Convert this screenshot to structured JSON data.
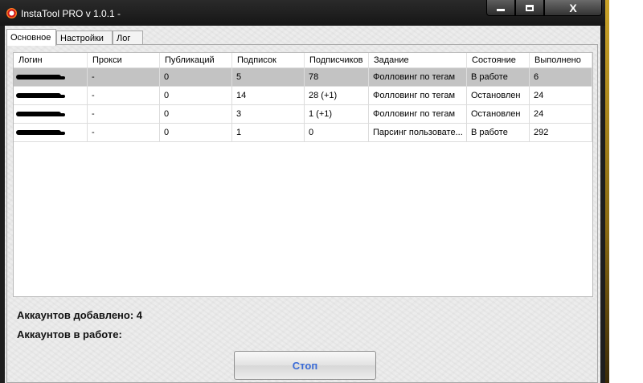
{
  "window": {
    "title": "InstaTool PRO v 1.0.1 -",
    "close_glyph": "X"
  },
  "tabs": [
    {
      "label": "Основное"
    },
    {
      "label": "Настройки"
    },
    {
      "label": "Лог"
    }
  ],
  "table": {
    "columns": [
      "Логин",
      "Прокси",
      "Публикаций",
      "Подписок",
      "Подписчиков",
      "Задание",
      "Состояние",
      "Выполнено"
    ],
    "rows": [
      {
        "proxy": "-",
        "posts": "0",
        "following": "5",
        "followers": "78",
        "task": "Фолловинг по тегам",
        "state": "В работе",
        "done": "6"
      },
      {
        "proxy": "-",
        "posts": "0",
        "following": "14",
        "followers": "28 (+1)",
        "task": "Фолловинг по тегам",
        "state": "Остановлен",
        "done": "24"
      },
      {
        "proxy": "-",
        "posts": "0",
        "following": "3",
        "followers": "1 (+1)",
        "task": "Фолловинг по тегам",
        "state": "Остановлен",
        "done": "24"
      },
      {
        "proxy": "-",
        "posts": "0",
        "following": "1",
        "followers": "0",
        "task": "Парсинг пользовате...",
        "state": "В работе",
        "done": "292"
      }
    ]
  },
  "status": {
    "accounts_added": "Аккаунтов добавлено: 4",
    "accounts_working": "Аккаунтов в работе:"
  },
  "buttons": {
    "stop_label": "Стоп"
  },
  "colors": {
    "selected_row": "#c3c3c3",
    "stop_text": "#3a6bd6",
    "titlebar": "#1e1e1e"
  }
}
